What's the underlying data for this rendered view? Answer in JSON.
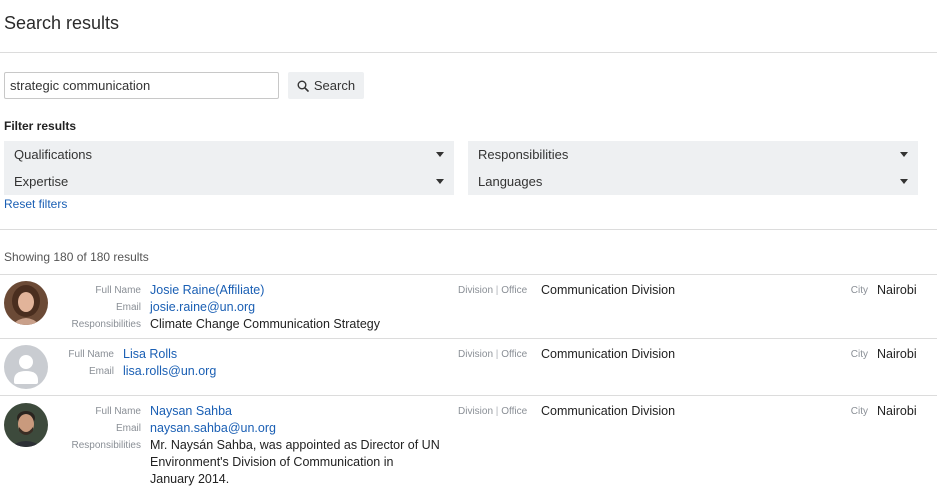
{
  "page": {
    "title": "Search results"
  },
  "search": {
    "value": "strategic communication",
    "button_label": "Search"
  },
  "filters": {
    "heading": "Filter results",
    "qualifications": "Qualifications",
    "expertise": "Expertise",
    "responsibilities": "Responsibilities",
    "languages": "Languages",
    "reset_label": "Reset filters"
  },
  "results": {
    "summary": "Showing 180 of 180 results",
    "labels": {
      "full_name": "Full Name",
      "email": "Email",
      "responsibilities": "Responsibilities",
      "division_part1": "Division",
      "division_sep": "|",
      "division_part2": "Office",
      "city": "City"
    },
    "people": [
      {
        "name": "Josie Raine(Affiliate)",
        "email": "josie.raine@un.org",
        "resp_lines": [
          "Climate Change Communication Strategy"
        ],
        "division": "Communication Division",
        "city": "Nairobi"
      },
      {
        "name": "Lisa Rolls",
        "email": "lisa.rolls@un.org",
        "resp_lines": [],
        "division": "Communication Division",
        "city": "Nairobi"
      },
      {
        "name": "Naysan Sahba",
        "email": "naysan.sahba@un.org",
        "resp_lines": [
          "Mr. Naysán Sahba, was appointed as Director of UN",
          "Environment's Division of Communication in",
          "January 2014."
        ],
        "division": "Communication Division",
        "city": "Nairobi"
      }
    ]
  }
}
